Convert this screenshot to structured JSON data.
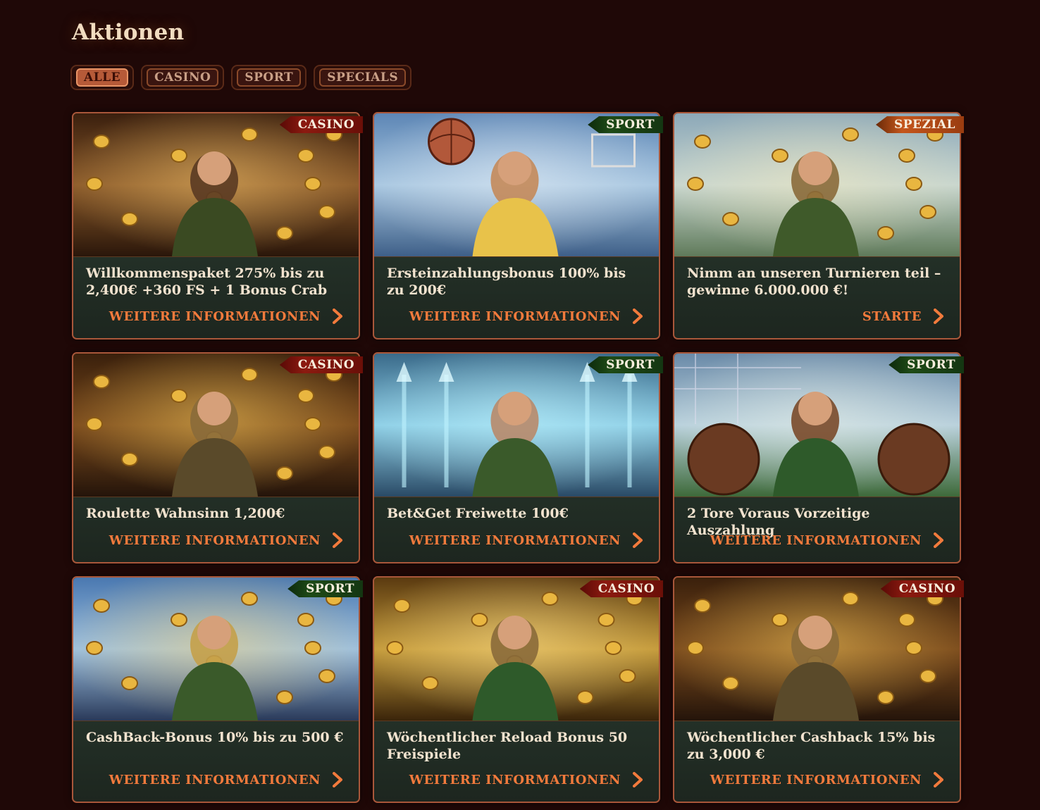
{
  "page": {
    "title": "Aktionen"
  },
  "filters": [
    "ALLE",
    "CASINO",
    "SPORT",
    "SPECIALS"
  ],
  "active_filter": "ALLE",
  "colors": {
    "accent": "#f27a3c",
    "background": "#1f0807",
    "casino_tag": "#8c1a10",
    "sport_tag": "#1e4a16",
    "special_tag": "#c4561c"
  },
  "cards": [
    {
      "tag": "CASINO",
      "tag_type": "casino",
      "title": "Willkommenspaket 275% bis zu 2,400€ +360 FS + 1 Bonus Crab",
      "cta": "WEITERE INFORMATIONEN",
      "image": "archers-tavern-cannon"
    },
    {
      "tag": "SPORT",
      "tag_type": "sport",
      "title": "Ersteinzahlungsbonus 100% bis zu 200€",
      "cta": "WEITERE INFORMATIONEN",
      "image": "basketball-giant"
    },
    {
      "tag": "SPEZIAL",
      "tag_type": "spezial",
      "title": "Nimm an unseren Turnieren teil – gewinne 6.000.000 €!",
      "cta": "STARTE",
      "image": "archer-castle-trophy"
    },
    {
      "tag": "CASINO",
      "tag_type": "casino",
      "title": "Roulette Wahnsinn 1,200€",
      "cta": "WEITERE INFORMATIONEN",
      "image": "coin-cannon"
    },
    {
      "tag": "SPORT",
      "tag_type": "sport",
      "title": "Bet&Get Freiwette 100€",
      "cta": "WEITERE INFORMATIONEN",
      "image": "archer-arrows-up"
    },
    {
      "tag": "SPORT",
      "tag_type": "sport",
      "title": "2 Tore Voraus Vorzeitige Auszahlung",
      "cta": "WEITERE INFORMATIONEN",
      "image": "football-goal"
    },
    {
      "tag": "SPORT",
      "tag_type": "sport",
      "title": "CashBack-Bonus 10% bis zu 500 €",
      "cta": "WEITERE INFORMATIONEN",
      "image": "king-throne"
    },
    {
      "tag": "CASINO",
      "tag_type": "casino",
      "title": "Wöchentlicher Reload Bonus 50 Freispiele",
      "cta": "WEITERE INFORMATIONEN",
      "image": "vault-hooded-man"
    },
    {
      "tag": "CASINO",
      "tag_type": "casino",
      "title": "Wöchentlicher Cashback 15% bis zu 3,000 €",
      "cta": "WEITERE INFORMATIONEN",
      "image": "coin-cannon"
    }
  ]
}
